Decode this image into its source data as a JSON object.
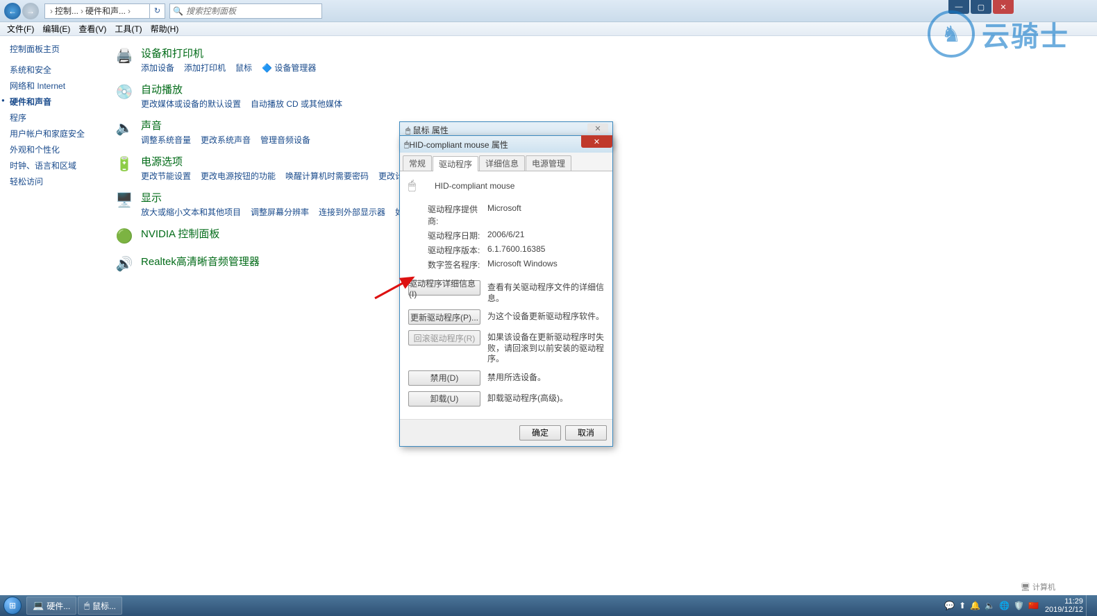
{
  "window_controls": {
    "close_glyph": "✕",
    "max_glyph": "▢",
    "min_glyph": "—"
  },
  "toolbar": {
    "back_glyph": "←",
    "fwd_glyph": "→",
    "breadcrumb": {
      "sep": "›",
      "item1": "控制...",
      "item2": "硬件和声...",
      "item3": ""
    },
    "search_placeholder": "搜索控制面板"
  },
  "menubar": [
    "文件(F)",
    "编辑(E)",
    "查看(V)",
    "工具(T)",
    "帮助(H)"
  ],
  "sidebar": {
    "title": "控制面板主页",
    "items": [
      "系统和安全",
      "网络和 Internet",
      "硬件和声音",
      "程序",
      "用户帐户和家庭安全",
      "外观和个性化",
      "时钟、语言和区域",
      "轻松访问"
    ],
    "active_index": 2
  },
  "categories": [
    {
      "icon": "🖨️",
      "title": "设备和打印机",
      "links": [
        "添加设备",
        "添加打印机",
        "鼠标",
        "🔷 设备管理器"
      ]
    },
    {
      "icon": "💿",
      "title": "自动播放",
      "links": [
        "更改媒体或设备的默认设置",
        "自动播放 CD 或其他媒体"
      ]
    },
    {
      "icon": "🔈",
      "title": "声音",
      "links": [
        "调整系统音量",
        "更改系统声音",
        "管理音频设备"
      ]
    },
    {
      "icon": "🔋",
      "title": "电源选项",
      "links": [
        "更改节能设置",
        "更改电源按钮的功能",
        "唤醒计算机时需要密码",
        "更改计算机睡眠时间"
      ]
    },
    {
      "icon": "🖥️",
      "title": "显示",
      "links": [
        "放大或缩小文本和其他项目",
        "调整屏幕分辨率",
        "连接到外部显示器",
        "如何更正显示器闪烁"
      ]
    },
    {
      "icon": "🟢",
      "title": "NVIDIA 控制面板",
      "links": []
    },
    {
      "icon": "🔊",
      "title": "Realtek高清晰音频管理器",
      "links": []
    }
  ],
  "dialog_back": {
    "title": "🖱 鼠标 属性",
    "close": "✕"
  },
  "dialog": {
    "title_prefix": "🖱 ",
    "title": "HID-compliant mouse 属性",
    "tabs": [
      "常规",
      "驱动程序",
      "详细信息",
      "电源管理"
    ],
    "active_tab": 1,
    "device_name": "HID-compliant mouse",
    "info": [
      {
        "label": "驱动程序提供商:",
        "value": "Microsoft"
      },
      {
        "label": "驱动程序日期:",
        "value": "2006/6/21"
      },
      {
        "label": "驱动程序版本:",
        "value": "6.1.7600.16385"
      },
      {
        "label": "数字签名程序:",
        "value": "Microsoft Windows"
      }
    ],
    "buttons": [
      {
        "label": "驱动程序详细信息(I)",
        "desc": "查看有关驱动程序文件的详细信息。",
        "disabled": false
      },
      {
        "label": "更新驱动程序(P)...",
        "desc": "为这个设备更新驱动程序软件。",
        "disabled": false
      },
      {
        "label": "回滚驱动程序(R)",
        "desc": "如果该设备在更新驱动程序时失败，请回滚到以前安装的驱动程序。",
        "disabled": true
      },
      {
        "label": "禁用(D)",
        "desc": "禁用所选设备。",
        "disabled": false
      },
      {
        "label": "卸载(U)",
        "desc": "卸载驱动程序(高级)。",
        "disabled": false
      }
    ],
    "footer": {
      "ok": "确定",
      "cancel": "取消"
    }
  },
  "watermark": {
    "glyph": "♞",
    "text": "云骑士"
  },
  "taskbar": {
    "items": [
      {
        "icon": "💻",
        "label": "硬件..."
      },
      {
        "icon": "🖱",
        "label": "鼠标..."
      }
    ],
    "tray_icons": [
      "💬",
      "⬆",
      "🔔",
      "🔈",
      "🌐",
      "🛡️",
      "🇨🇳"
    ],
    "clock": {
      "time": "11:29",
      "date": "2019/12/12"
    },
    "desktop_label": "🖥 计算机"
  }
}
